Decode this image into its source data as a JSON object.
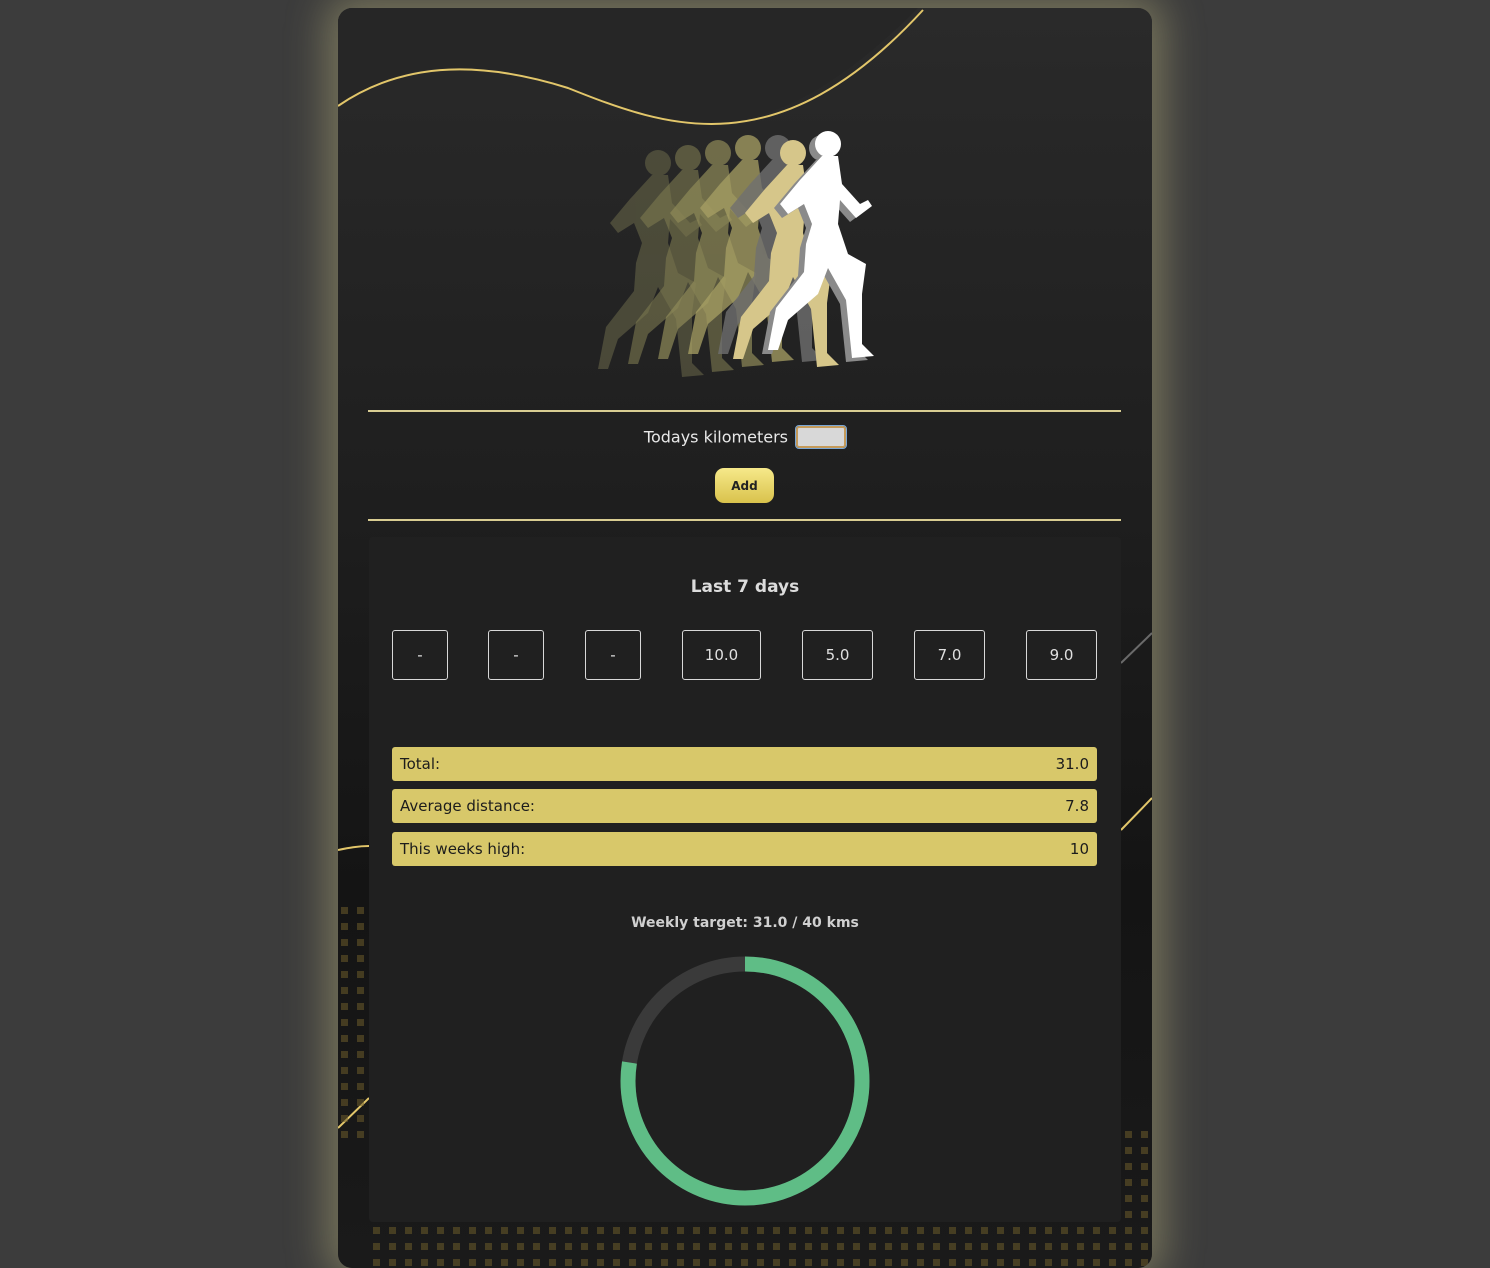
{
  "entry": {
    "label": "Todays kilometers",
    "input_value": "",
    "add_label": "Add"
  },
  "last7": {
    "title": "Last 7 days",
    "days": [
      "-",
      "-",
      "-",
      "10.0",
      "5.0",
      "7.0",
      "9.0"
    ]
  },
  "stats": {
    "total_label": "Total:",
    "total_value": "31.0",
    "average_label": "Average distance:",
    "average_value": "7.8",
    "high_label": "This weeks high:",
    "high_value": "10"
  },
  "target": {
    "label": "Weekly target: 31.0 / 40 kms",
    "current": 31.0,
    "goal": 40,
    "progress_color": "#5fbd86",
    "track_color": "#3a3a3a"
  },
  "colors": {
    "accent_gold": "#d8c86a",
    "background": "#3c3c3c"
  },
  "icons": {
    "hero": "runners-silhouette-icon"
  }
}
